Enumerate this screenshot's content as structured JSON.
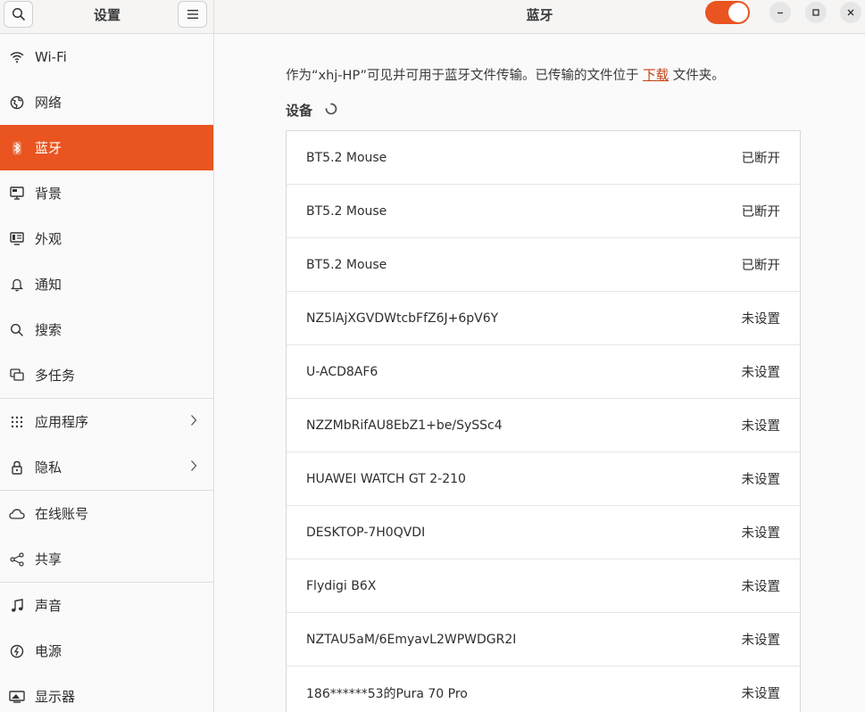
{
  "sidebar": {
    "title": "设置",
    "items": [
      {
        "label": "Wi-Fi",
        "icon": "wifi-icon"
      },
      {
        "label": "网络",
        "icon": "network-icon"
      },
      {
        "label": "蓝牙",
        "icon": "bluetooth-icon"
      },
      {
        "label": "背景",
        "icon": "background-icon"
      },
      {
        "label": "外观",
        "icon": "appearance-icon"
      },
      {
        "label": "通知",
        "icon": "bell-icon"
      },
      {
        "label": "搜索",
        "icon": "search-icon"
      },
      {
        "label": "多任务",
        "icon": "multitask-icon"
      },
      {
        "label": "应用程序",
        "icon": "apps-grid-icon"
      },
      {
        "label": "隐私",
        "icon": "lock-icon"
      },
      {
        "label": "在线账号",
        "icon": "cloud-icon"
      },
      {
        "label": "共享",
        "icon": "share-icon"
      },
      {
        "label": "声音",
        "icon": "music-note-icon"
      },
      {
        "label": "电源",
        "icon": "power-icon"
      },
      {
        "label": "显示器",
        "icon": "display-icon"
      }
    ]
  },
  "header": {
    "title": "蓝牙",
    "bluetooth_enabled": true,
    "accent_color": "#e95420"
  },
  "main": {
    "info_prefix": "作为“xhj-HP”可见并可用于蓝牙文件传输。已传输的文件位于 ",
    "info_link": "下载",
    "info_suffix": " 文件夹。",
    "devices_heading": "设备",
    "devices": [
      {
        "name": "BT5.2 Mouse",
        "status": "已断开"
      },
      {
        "name": "BT5.2 Mouse",
        "status": "已断开"
      },
      {
        "name": "BT5.2 Mouse",
        "status": "已断开"
      },
      {
        "name": "NZ5lAjXGVDWtcbFfZ6J+6pV6Y",
        "status": "未设置"
      },
      {
        "name": "U-ACD8AF6",
        "status": "未设置"
      },
      {
        "name": "NZZMbRifAU8EbZ1+be/SySSc4",
        "status": "未设置"
      },
      {
        "name": "HUAWEI WATCH GT 2-210",
        "status": "未设置"
      },
      {
        "name": "DESKTOP-7H0QVDI",
        "status": "未设置"
      },
      {
        "name": "Flydigi B6X",
        "status": "未设置"
      },
      {
        "name": "NZTAU5aM/6EmyavL2WPWDGR2I",
        "status": "未设置"
      },
      {
        "name": "186******53的Pura 70 Pro",
        "status": "未设置"
      }
    ]
  }
}
